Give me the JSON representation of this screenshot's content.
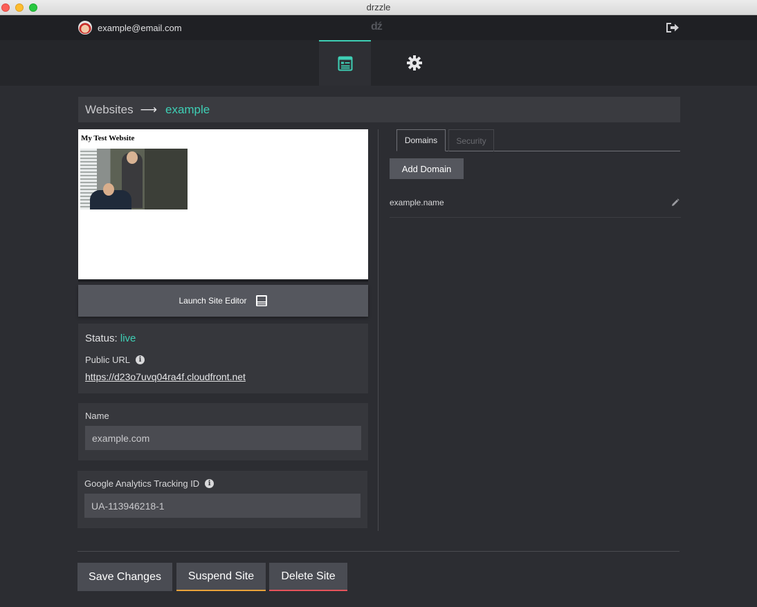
{
  "window": {
    "title": "drzzle"
  },
  "topbar": {
    "email": "example@email.com",
    "logo": "dź"
  },
  "breadcrumb": {
    "root": "Websites",
    "arrow": "⟶",
    "current": "example"
  },
  "preview": {
    "title": "My Test Website"
  },
  "launch": {
    "label": "Launch Site Editor"
  },
  "status": {
    "label": "Status:",
    "value": "live",
    "url_label": "Public URL",
    "url": "https://d23o7uvq04ra4f.cloudfront.net"
  },
  "name_field": {
    "label": "Name",
    "value": "example.com"
  },
  "ga_field": {
    "label": "Google Analytics Tracking ID",
    "value": "UA-113946218-1"
  },
  "tabs": [
    {
      "label": "Domains",
      "active": true
    },
    {
      "label": "Security",
      "active": false
    }
  ],
  "domains": {
    "add_label": "Add Domain",
    "items": [
      {
        "name": "example.name"
      }
    ]
  },
  "actions": {
    "save": "Save Changes",
    "suspend": "Suspend Site",
    "delete": "Delete Site"
  },
  "colors": {
    "accent": "#3ecfb5",
    "warning": "#e8a33b",
    "danger": "#e5545c"
  }
}
